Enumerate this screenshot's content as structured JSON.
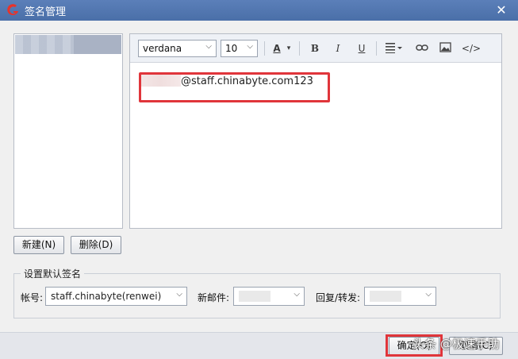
{
  "window": {
    "title": "签名管理",
    "close_glyph": "✕"
  },
  "signature_list": {
    "items": [
      ""
    ]
  },
  "toolbar": {
    "font": "verdana",
    "size": "10",
    "icons": [
      "text-color-icon",
      "bold-icon",
      "italic-icon",
      "underline-icon",
      "align-icon",
      "link-icon",
      "image-icon",
      "code-icon"
    ],
    "bold": "B",
    "italic": "I",
    "underline": "U",
    "text_color": "A",
    "code": "</>"
  },
  "editor": {
    "content": "@staff.chinabyte.com123"
  },
  "buttons": {
    "new": "新建(N)",
    "delete": "删除(D)",
    "ok": "确定(O)",
    "cancel": "取消(C)"
  },
  "default_signature": {
    "group_title": "设置默认签名",
    "account_label": "帐号:",
    "account_value": "staff.chinabyte(renwei)",
    "new_mail_label": "新邮件:",
    "reply_label": "回复/转发:"
  },
  "watermark": "头条 @极速手助",
  "colors": {
    "titlebar": "#4a6fa8",
    "highlight": "#e0353b"
  }
}
